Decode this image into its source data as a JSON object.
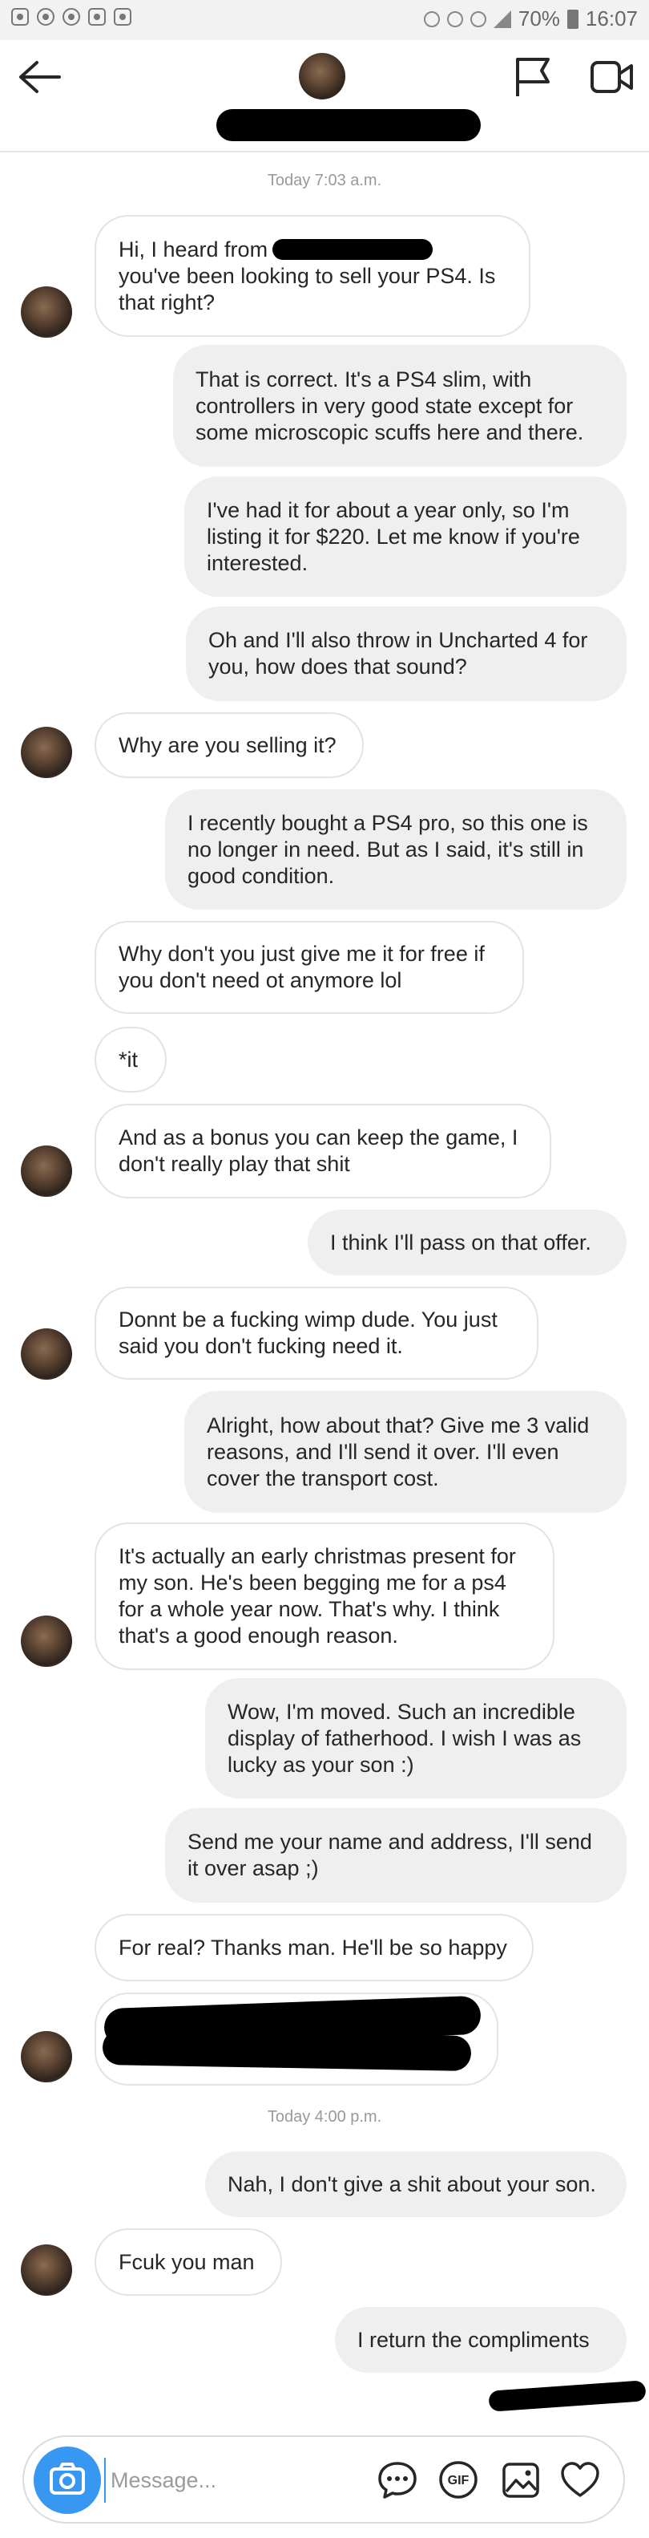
{
  "status_bar": {
    "battery": "70%",
    "time": "16:07"
  },
  "chat": {
    "timestamps": [
      "Today 7:03 a.m.",
      "Today 4:00 p.m."
    ],
    "messages": [
      "Hi, I heard from                     that\nyou've been looking to sell your PS4. Is\nthat right?",
      "That is correct. It's a PS4 slim, with\ncontrollers in very good state except for\nsome microscopic scuffs here and there.",
      "I've had it for about a year only, so I'm\nlisting it for $220. Let me know if you're\ninterested.",
      "Oh and I'll also throw in Uncharted 4 for\nyou, how does that sound?",
      "Why are you selling it?",
      "I recently bought a PS4 pro, so this one is\nno longer in need. But as I said, it's still in\ngood condition.",
      "Why don't you just give me it for free if\nyou don't need ot anymore lol",
      "*it",
      "And as a bonus you can keep the game, I\ndon't really play that shit",
      "I think I'll pass on that offer.",
      "Donnt be a fucking wimp dude. You just\nsaid you don't fucking need it.",
      "Alright, how about that? Give me 3 valid\nreasons, and I'll send it over. I'll even\ncover the transport cost.",
      "It's actually an early christmas present for\nmy son. He's been begging me for a ps4\nfor a whole year now. That's why. I think\nthat's a good enough reason.",
      "Wow, I'm moved. Such an incredible\ndisplay of fatherhood. I wish I was as\nlucky as your son :)",
      "Send me your name and address, I'll send\nit over asap ;)",
      "For real? Thanks man. He'll be so happy",
      "",
      "Nah, I don't give a shit about your son.",
      "Fcuk you man",
      "I return the compliments"
    ]
  },
  "composer": {
    "placeholder": "Message...",
    "gif_label": "GIF"
  },
  "icons": {
    "back": "arrow-left-icon",
    "flag": "flag-icon",
    "video": "video-camera-icon",
    "camera": "camera-icon",
    "chat": "chat-bubble-icon",
    "gif": "gif-icon",
    "image": "image-icon",
    "heart": "heart-icon"
  },
  "colors": {
    "accent": "#3897f0",
    "bubble_out": "#efefef",
    "bubble_in_border": "#e3e3e3",
    "timestamp": "#999999"
  }
}
